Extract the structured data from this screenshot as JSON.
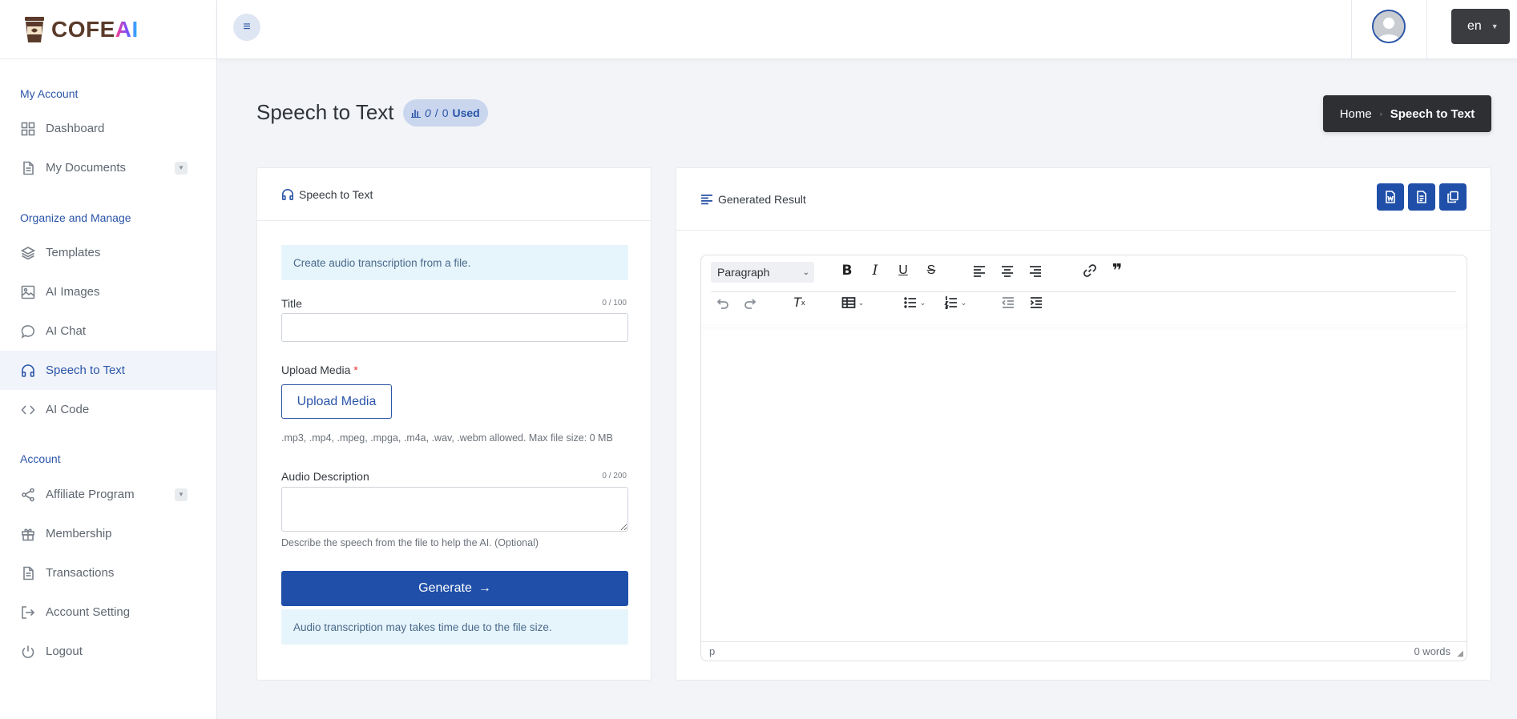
{
  "brand": {
    "name_part1": "COFE",
    "name_part2": "AI"
  },
  "sidebar": {
    "sections": [
      {
        "label": "My Account"
      },
      {
        "label": "Organize and Manage"
      },
      {
        "label": "Account"
      }
    ],
    "items": [
      {
        "label": "Dashboard",
        "icon": "grid-icon"
      },
      {
        "label": "My Documents",
        "icon": "document-icon",
        "has_submenu": true
      },
      {
        "label": "Templates",
        "icon": "layers-icon"
      },
      {
        "label": "AI Images",
        "icon": "image-icon"
      },
      {
        "label": "AI Chat",
        "icon": "chat-icon"
      },
      {
        "label": "Speech to Text",
        "icon": "headphones-icon",
        "active": true
      },
      {
        "label": "AI Code",
        "icon": "code-icon"
      },
      {
        "label": "Affiliate Program",
        "icon": "share-icon",
        "has_submenu": true
      },
      {
        "label": "Membership",
        "icon": "gift-icon"
      },
      {
        "label": "Transactions",
        "icon": "receipt-icon"
      },
      {
        "label": "Account Setting",
        "icon": "logout-arrow-icon"
      },
      {
        "label": "Logout",
        "icon": "power-icon"
      }
    ]
  },
  "topbar": {
    "language": "en"
  },
  "page": {
    "title": "Speech to Text",
    "usage": {
      "used": "0",
      "sep": "/",
      "total": "0",
      "label": "Used"
    }
  },
  "breadcrumb": {
    "home": "Home",
    "current": "Speech to Text"
  },
  "form": {
    "header": "Speech to Text",
    "info": "Create audio transcription from a file.",
    "title_label": "Title",
    "title_counter": "0 / 100",
    "title_value": "",
    "upload_label": "Upload Media",
    "upload_required": "*",
    "upload_button": "Upload Media",
    "upload_hint": ".mp3, .mp4, .mpeg, .mpga, .m4a, .wav, .webm allowed. Max file size: 0 MB",
    "description_label": "Audio Description",
    "description_counter": "0 / 200",
    "description_value": "",
    "description_hint": "Describe the speech from the file to help the AI. (Optional)",
    "generate_button": "Generate",
    "note": "Audio transcription may takes time due to the file size."
  },
  "result": {
    "header": "Generated Result",
    "actions": [
      "word-export-icon",
      "document-export-icon",
      "copy-icon"
    ],
    "editor": {
      "block_format": "Paragraph",
      "path": "p",
      "word_count": "0 words"
    }
  },
  "colors": {
    "primary": "#1f4fa8",
    "accent_text": "#2b55a8",
    "sidebar_active_bg": "#f1f4fa",
    "info_bg": "#e6f4fc",
    "breadcrumb_bg": "#2d2f33"
  }
}
